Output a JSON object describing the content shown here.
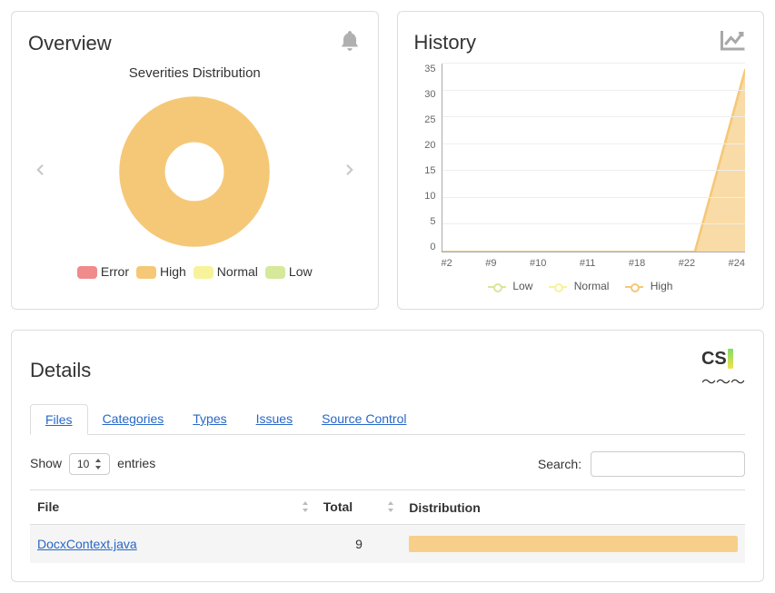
{
  "overview": {
    "title": "Overview",
    "subtitle": "Severities Distribution",
    "legend": [
      {
        "label": "Error",
        "color": "#f08b8b"
      },
      {
        "label": "High",
        "color": "#f5c878"
      },
      {
        "label": "Normal",
        "color": "#f7f39a"
      },
      {
        "label": "Low",
        "color": "#d6e89a"
      }
    ]
  },
  "history": {
    "title": "History",
    "legend": [
      {
        "label": "Low",
        "color": "#d6e89a"
      },
      {
        "label": "Normal",
        "color": "#f7f39a"
      },
      {
        "label": "High",
        "color": "#f5c878"
      }
    ]
  },
  "details": {
    "title": "Details",
    "tabs": [
      "Files",
      "Categories",
      "Types",
      "Issues",
      "Source Control"
    ],
    "active_tab": 0,
    "show_label_prefix": "Show",
    "show_label_suffix": "entries",
    "show_value": "10",
    "search_label": "Search:",
    "columns": [
      "File",
      "Total",
      "Distribution"
    ],
    "rows": [
      {
        "file": "DocxContext.java",
        "total": "9"
      }
    ]
  },
  "colors": {
    "high": "#f5c878"
  },
  "chart_data": [
    {
      "type": "pie",
      "title": "Severities Distribution",
      "series": [
        {
          "name": "Error",
          "value": 0,
          "color": "#f08b8b"
        },
        {
          "name": "High",
          "value": 9,
          "color": "#f5c878"
        },
        {
          "name": "Normal",
          "value": 0,
          "color": "#f7f39a"
        },
        {
          "name": "Low",
          "value": 0,
          "color": "#d6e89a"
        }
      ]
    },
    {
      "type": "area",
      "title": "History",
      "x": [
        "#2",
        "#9",
        "#10",
        "#11",
        "#18",
        "#22",
        "#24"
      ],
      "series": [
        {
          "name": "Low",
          "color": "#d6e89a",
          "values": [
            0,
            0,
            0,
            0,
            0,
            0,
            0
          ]
        },
        {
          "name": "Normal",
          "color": "#f7f39a",
          "values": [
            0,
            0,
            0,
            0,
            0,
            0,
            0
          ]
        },
        {
          "name": "High",
          "color": "#f5c878",
          "values": [
            0,
            0,
            0,
            0,
            0,
            0,
            34
          ]
        }
      ],
      "ylabel": "",
      "xlabel": "",
      "ylim": [
        0,
        35
      ],
      "yticks": [
        0,
        5,
        10,
        15,
        20,
        25,
        30,
        35
      ]
    }
  ]
}
